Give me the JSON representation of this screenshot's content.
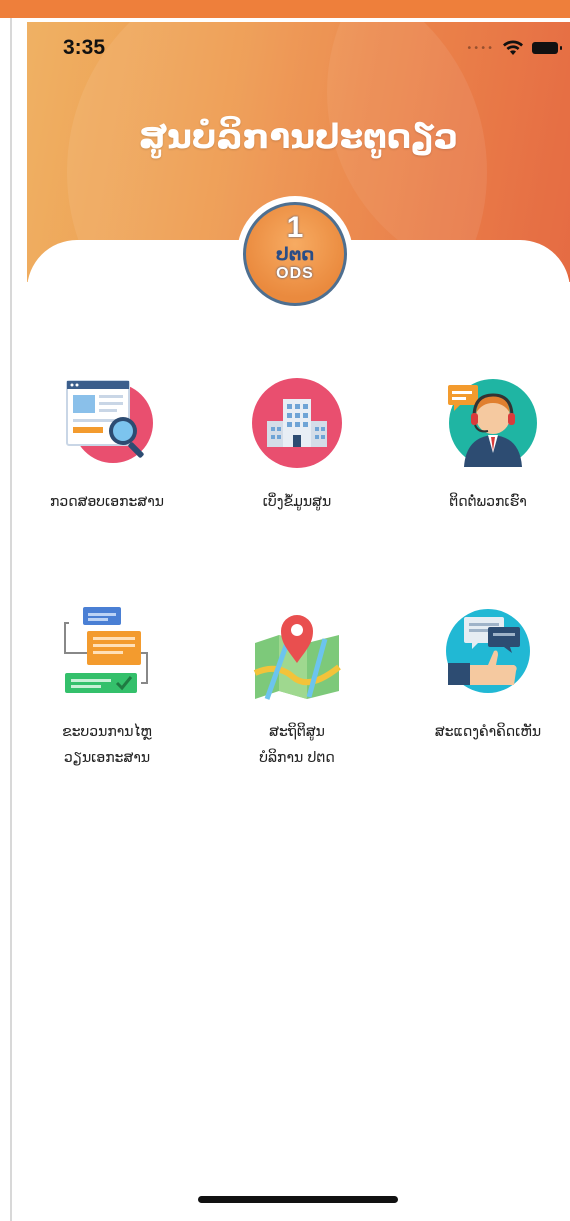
{
  "status_bar": {
    "time": "3:35",
    "signal": "••••",
    "icons": [
      "wifi-icon",
      "battery-icon"
    ]
  },
  "header": {
    "title": "ສູນບໍລິການປະຕູດຽວ"
  },
  "logo": {
    "number": "1",
    "lao_text": "ປຕດ",
    "latin_text": "ODS"
  },
  "menu": {
    "items": [
      {
        "label_line1": "ກວດສອບເອກະສານ",
        "label_line2": "",
        "icon": "document-search-icon"
      },
      {
        "label_line1": "ເບິ່ງຂໍ້ມູນສູນ",
        "label_line2": "",
        "icon": "building-icon"
      },
      {
        "label_line1": "ຕິດຕໍ່ພວກເຮົາ",
        "label_line2": "",
        "icon": "support-agent-icon"
      },
      {
        "label_line1": "ຂະບວນການໄຫຼ",
        "label_line2": "ວຽນເອກະສານ",
        "icon": "document-flow-icon"
      },
      {
        "label_line1": "ສະຖິຕິສູນ",
        "label_line2": "ບໍລິການ ປຕດ",
        "icon": "map-pin-icon"
      },
      {
        "label_line1": "ສະແດງຄຳຄິດເຫັນ",
        "label_line2": "",
        "icon": "feedback-thumb-icon"
      }
    ]
  },
  "colors": {
    "accent": "#ee7f3b",
    "header_start": "#efb164",
    "header_end": "#e46238",
    "icon_pink": "#e94f6f",
    "icon_teal": "#1fb5a3",
    "icon_cyan": "#21b8d4"
  }
}
